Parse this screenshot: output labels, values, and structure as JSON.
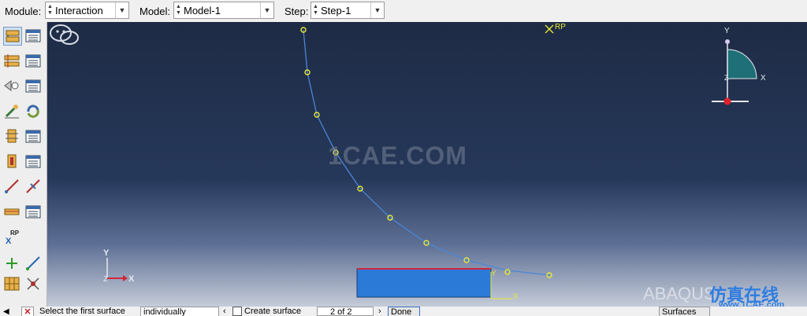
{
  "toolbar": {
    "module_label": "Module:",
    "module_value": "Interaction",
    "model_label": "Model:",
    "model_value": "Model-1",
    "step_label": "Step:",
    "step_value": "Step-1"
  },
  "viewport": {
    "rp_label": "RP",
    "watermark": "1CAE.COM",
    "triad_y": "Y",
    "triad_x": "X",
    "triad_z": "Z",
    "view_triad_y": "Y",
    "view_triad_x": "X",
    "view_triad_z": "Z",
    "part_y": "Y",
    "part_x": "X"
  },
  "toolbox": {
    "rp_tool_label": "RP",
    "rp_tool_x": "X"
  },
  "brand": {
    "abaqus": "ABAQUS",
    "cn": "仿真在线",
    "url": "www.1CAE.com"
  },
  "statusbar": {
    "prompt": "Select the first surface",
    "select_value": "individually",
    "checkbox_label": "Create surface",
    "counter": "2 of 2",
    "done_label": "Done",
    "right_button": "Surfaces"
  },
  "colors": {
    "curve": "#4a86d6",
    "node": "#e8e832",
    "part_fill": "#2b7ad8",
    "part_edge": "#d0283a",
    "triad_fill": "#1f6f78"
  }
}
